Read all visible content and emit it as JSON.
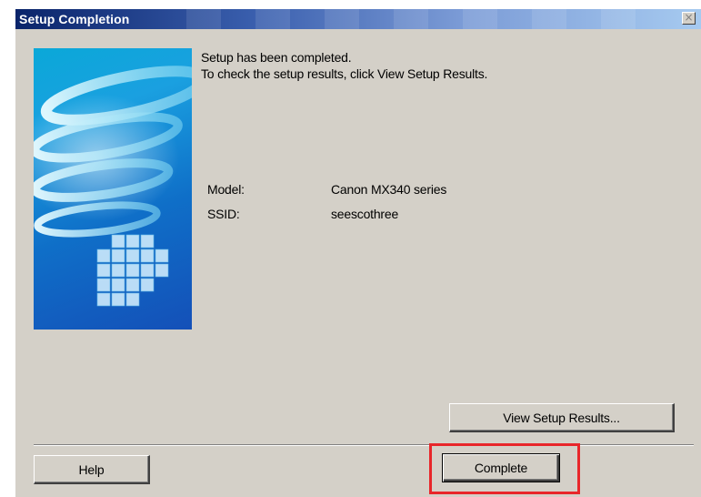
{
  "window": {
    "title": "Setup Completion",
    "close_glyph": "×"
  },
  "message": {
    "line1": "Setup has been completed.",
    "line2": "To check the setup results, click View Setup Results."
  },
  "info": [
    {
      "label": "Model:",
      "value": "Canon MX340 series"
    },
    {
      "label": "SSID:",
      "value": "seescothree"
    }
  ],
  "buttons": {
    "view_results": "View Setup Results...",
    "help": "Help",
    "complete": "Complete"
  },
  "colors": {
    "dialog_bg": "#d4d0c8",
    "title_start": "#0a246a",
    "title_end": "#a6caf0",
    "highlight": "#e8262a"
  }
}
